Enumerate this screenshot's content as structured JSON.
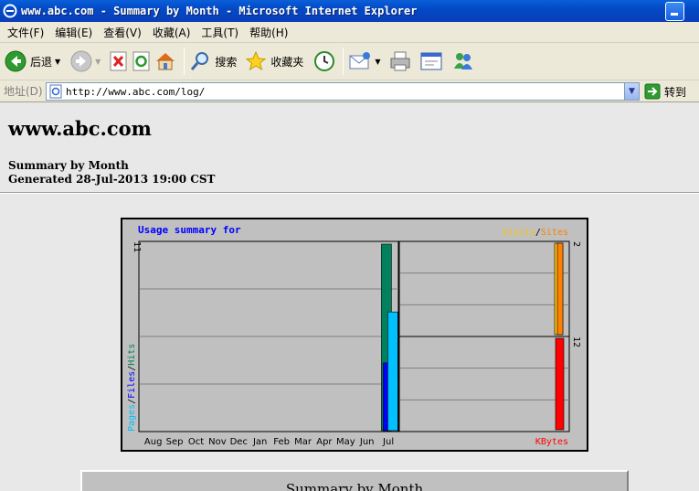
{
  "window": {
    "title": "www.abc.com - Summary by Month - Microsoft Internet Explorer"
  },
  "menu": {
    "items": [
      "文件(F)",
      "编辑(E)",
      "查看(V)",
      "收藏(A)",
      "工具(T)",
      "帮助(H)"
    ]
  },
  "toolbar": {
    "back_label": "后退",
    "search_label": "搜索",
    "favorites_label": "收藏夹"
  },
  "address": {
    "label": "地址(D)",
    "url": "http://www.abc.com/log/",
    "go_label": "转到"
  },
  "page": {
    "site_title": "www.abc.com",
    "summary_line": "Summary by Month",
    "generated_line": "Generated 28-Jul-2013 19:00 CST",
    "table_title": "Summary by Month"
  },
  "colors": {
    "hits": "#00805c",
    "files": "#0000ff",
    "pages": "#00c0ff",
    "visits": "#ffc000",
    "sites": "#ff8000",
    "kbytes": "#ff0000",
    "heading": "#0000ff"
  },
  "chart_data": {
    "type": "bar",
    "title": "Usage summary for",
    "categories": [
      "Aug",
      "Sep",
      "Oct",
      "Nov",
      "Dec",
      "Jan",
      "Feb",
      "Mar",
      "Apr",
      "May",
      "Jun",
      "Jul"
    ],
    "left_panel": {
      "max_label": "11",
      "ylim": [
        0,
        11
      ],
      "legend": [
        "Pages",
        "Files",
        "Hits"
      ],
      "series": [
        {
          "name": "Hits",
          "values": [
            0,
            0,
            0,
            0,
            0,
            0,
            0,
            0,
            0,
            0,
            0,
            11
          ]
        },
        {
          "name": "Files",
          "values": [
            0,
            0,
            0,
            0,
            0,
            0,
            0,
            0,
            0,
            0,
            0,
            4
          ]
        },
        {
          "name": "Pages",
          "values": [
            0,
            0,
            0,
            0,
            0,
            0,
            0,
            0,
            0,
            0,
            0,
            7
          ]
        }
      ]
    },
    "top_right_panel": {
      "max_label": "2",
      "ylim": [
        0,
        2
      ],
      "legend": [
        "Visits",
        "Sites"
      ],
      "series": [
        {
          "name": "Visits",
          "values": [
            0,
            0,
            0,
            0,
            0,
            0,
            0,
            0,
            0,
            0,
            0,
            2
          ]
        },
        {
          "name": "Sites",
          "values": [
            0,
            0,
            0,
            0,
            0,
            0,
            0,
            0,
            0,
            0,
            0,
            2
          ]
        }
      ]
    },
    "bottom_right_panel": {
      "max_label": "12",
      "ylim": [
        0,
        12
      ],
      "legend": [
        "KBytes"
      ],
      "series": [
        {
          "name": "KBytes",
          "values": [
            0,
            0,
            0,
            0,
            0,
            0,
            0,
            0,
            0,
            0,
            0,
            12
          ]
        }
      ]
    },
    "grid": true
  }
}
